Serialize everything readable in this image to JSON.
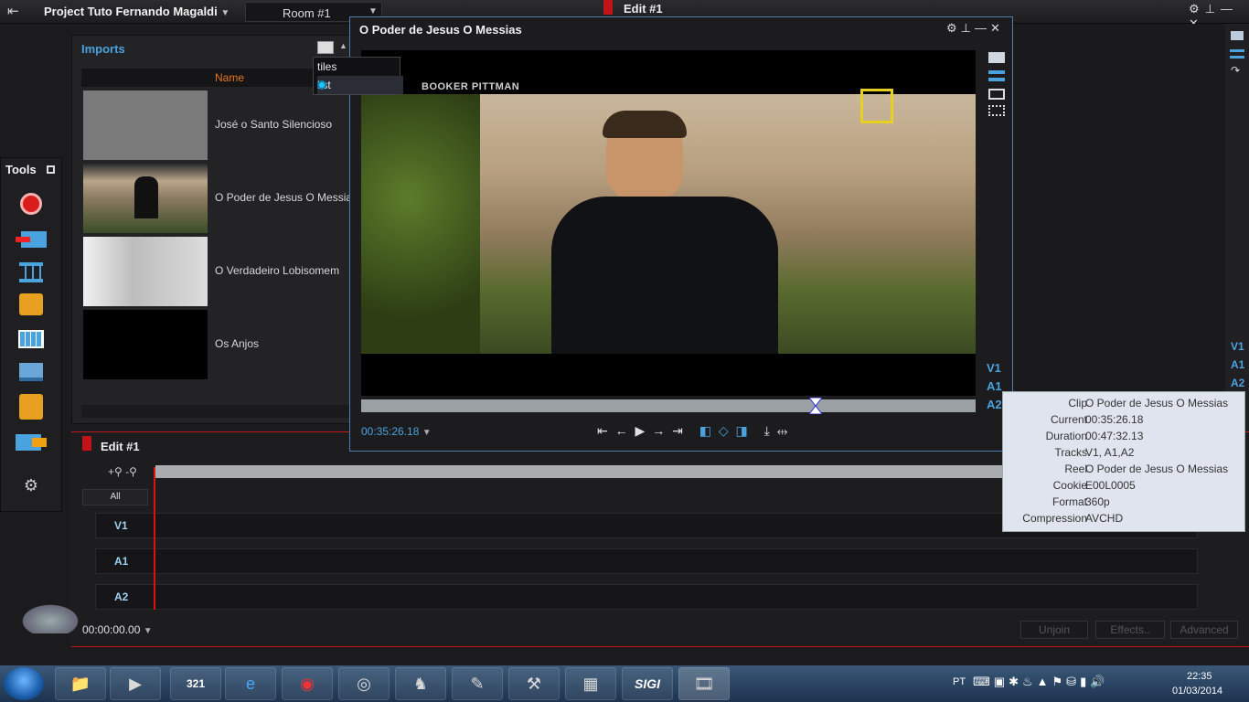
{
  "topbar": {
    "project_title": "Project Tuto Fernando Magaldi",
    "project_chevron": "▼",
    "room": "Room #1",
    "room_chevron": "▼",
    "edit_title": "Edit #1",
    "icons": [
      "gear-icon",
      "pin-icon",
      "minimize-icon",
      "close-icon"
    ]
  },
  "imports": {
    "title": "Imports",
    "column_name": "Name",
    "items": [
      {
        "name": "José o Santo Silencioso"
      },
      {
        "name": "O Poder de Jesus   O Messias"
      },
      {
        "name": "O Verdadeiro Lobisomem"
      },
      {
        "name": "Os Anjos"
      }
    ]
  },
  "view_menu": {
    "options": [
      "tiles",
      "list"
    ],
    "selected": "list"
  },
  "tools": {
    "title": "Tools",
    "items": [
      "record-icon",
      "import-icon",
      "timeline-icon",
      "search-icon",
      "grid-icon",
      "stack-icon",
      "export-icon",
      "send-icon",
      "users-icon"
    ]
  },
  "preview": {
    "title": "O Poder de Jesus   O Messias",
    "overlay_text": "BOOKER PITTMAN",
    "timecode": "00:35:26.18",
    "timecode_chevron": "▼",
    "controls": "⇤ ← ▶ → ⇥",
    "tracks": [
      "V1",
      "A1",
      "A2"
    ],
    "scrub_position": 0.74
  },
  "tooltip": {
    "rows": [
      {
        "k": "Clip",
        "v": "O Poder de Jesus   O Messias"
      },
      {
        "k": "Current",
        "v": "00:35:26.18"
      },
      {
        "k": "Duration",
        "v": "00:47:32.13"
      },
      {
        "k": "Tracks",
        "v": "V1, A1,A2"
      },
      {
        "k": "Reel",
        "v": "O Poder de Jesus   O Messias"
      },
      {
        "k": "Cookie",
        "v": "E00L0005"
      },
      {
        "k": "Format",
        "v": "360p"
      },
      {
        "k": "Compression",
        "v": "AVCHD"
      }
    ]
  },
  "right_tracks": [
    "V1",
    "A1",
    "A2"
  ],
  "timeline": {
    "title": "Edit #1",
    "zoom": "+🔍 -🔍",
    "all_label": "All",
    "tracks": [
      "V1",
      "A1",
      "A2"
    ],
    "timecode": "00:00:00.00",
    "timecode_chevron": "▼",
    "buttons": {
      "unjoin": "Unjoin",
      "effects": "Effects..",
      "advanced": "Advanced"
    }
  },
  "taskbar": {
    "lang": "PT",
    "time": "22:35",
    "date": "01/03/2014",
    "apps": [
      "explorer-icon",
      "media-player-icon",
      "media-player-classic-icon",
      "internet-explorer-icon",
      "chrome-icon",
      "windows-dvd-icon",
      "horse-app-icon",
      "pencil-app-icon",
      "wrench-app-icon",
      "calculator-icon",
      "sigi-app-icon",
      "lightworks-icon"
    ],
    "app_labels": {
      "mpc": "321",
      "sigi": "SIGI"
    }
  }
}
